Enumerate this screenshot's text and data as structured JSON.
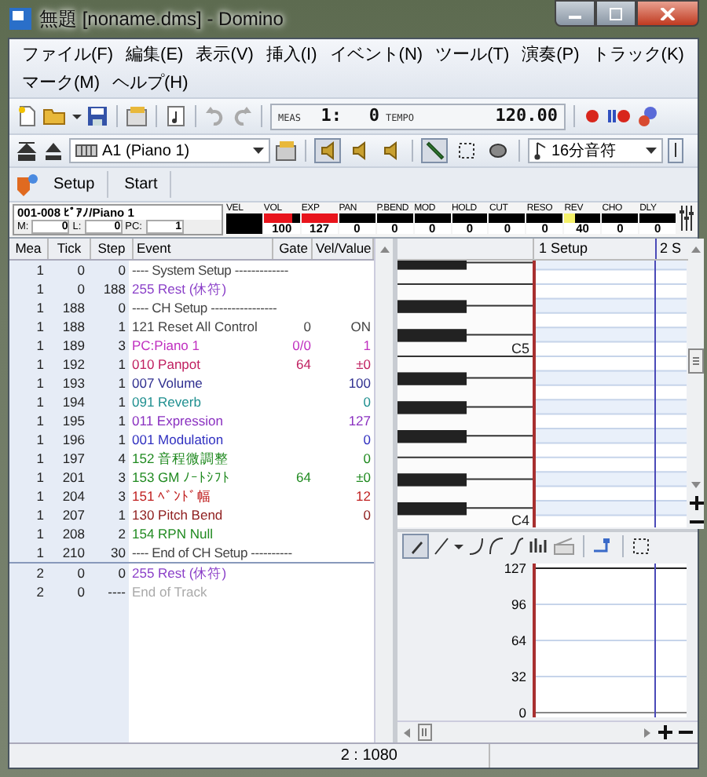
{
  "window": {
    "title": "無題 [noname.dms] - Domino"
  },
  "menu": [
    "ファイル(F)",
    "編集(E)",
    "表示(V)",
    "挿入(I)",
    "イベント(N)",
    "ツール(T)",
    "演奏(P)",
    "トラック(K)",
    "マーク(M)",
    "ヘルプ(H)"
  ],
  "transport": {
    "meas_label": "MEAS",
    "measure": "1:",
    "tick": "0",
    "tempo_label": "TEMPO",
    "tempo": "120.00"
  },
  "track_bar": {
    "track": "A1 (Piano 1)",
    "monitor_buttons": [
      {
        "selected": true
      },
      {
        "selected": false
      },
      {
        "selected": false
      }
    ],
    "tools": [
      {
        "kind": "pencil",
        "selected": true
      },
      {
        "kind": "select",
        "selected": false
      },
      {
        "kind": "eraser",
        "selected": false
      }
    ],
    "note_length": "16分音符"
  },
  "tabs": [
    {
      "label": "Setup"
    },
    {
      "label": "Start"
    }
  ],
  "channel_info": {
    "instrument": "001-008 ﾋﾟｱﾉ/Piano 1",
    "fields": [
      {
        "label": "M:",
        "value": "0"
      },
      {
        "label": "L:",
        "value": "0"
      },
      {
        "label": "PC:",
        "value": "1"
      }
    ],
    "meters": [
      {
        "label": "VEL"
      },
      {
        "label": "VOL",
        "value": "100",
        "level": 0.79,
        "color": "#e8141c"
      },
      {
        "label": "EXP",
        "value": "127",
        "level": 1,
        "color": "#e8141c"
      },
      {
        "label": "PAN",
        "value": "0"
      },
      {
        "label": "P.BEND",
        "value": "0"
      },
      {
        "label": "MOD",
        "value": "0"
      },
      {
        "label": "HOLD",
        "value": "0"
      },
      {
        "label": "CUT",
        "value": "0"
      },
      {
        "label": "RESO",
        "value": "0"
      },
      {
        "label": "REV",
        "value": "40",
        "level": 0.31,
        "color": "#f4f06a"
      },
      {
        "label": "CHO",
        "value": "0"
      },
      {
        "label": "DLY",
        "value": "0"
      }
    ]
  },
  "event_list": {
    "columns": [
      "Mea",
      "Tick",
      "Step",
      "Event",
      "Gate",
      "Vel/Value"
    ],
    "rows": [
      {
        "kind": "separator",
        "mea": "1",
        "tick": "0",
        "step": "0",
        "event": "---- System Setup -------------"
      },
      {
        "kind": "event",
        "mea": "1",
        "tick": "0",
        "step": "188",
        "event": "255 Rest (休符)",
        "color": "#8a3fc8"
      },
      {
        "kind": "separator",
        "mea": "1",
        "tick": "188",
        "step": "0",
        "event": "---- CH Setup ----------------"
      },
      {
        "kind": "event",
        "mea": "1",
        "tick": "188",
        "step": "1",
        "event": "121 Reset All Control",
        "gate": "0",
        "value": "ON",
        "color": "#444444"
      },
      {
        "kind": "event",
        "mea": "1",
        "tick": "189",
        "step": "3",
        "event": "PC:Piano 1",
        "gate": "0/0",
        "value": "1",
        "color": "#c030c0"
      },
      {
        "kind": "event",
        "mea": "1",
        "tick": "192",
        "step": "1",
        "event": "010 Panpot",
        "gate": "64",
        "value": "±0",
        "color": "#c02060"
      },
      {
        "kind": "event",
        "mea": "1",
        "tick": "193",
        "step": "1",
        "event": "007 Volume",
        "value": "100",
        "color": "#303090"
      },
      {
        "kind": "event",
        "mea": "1",
        "tick": "194",
        "step": "1",
        "event": "091 Reverb",
        "value": "0",
        "color": "#209090"
      },
      {
        "kind": "event",
        "mea": "1",
        "tick": "195",
        "step": "1",
        "event": "011 Expression",
        "value": "127",
        "color": "#8a30c0"
      },
      {
        "kind": "event",
        "mea": "1",
        "tick": "196",
        "step": "1",
        "event": "001 Modulation",
        "value": "0",
        "color": "#3030c0"
      },
      {
        "kind": "event",
        "mea": "1",
        "tick": "197",
        "step": "4",
        "event": "152 音程微調整",
        "value": "0",
        "color": "#208a20"
      },
      {
        "kind": "event",
        "mea": "1",
        "tick": "201",
        "step": "3",
        "event": "153 GM ﾉｰﾄｼﾌﾄ",
        "gate": "64",
        "value": "±0",
        "color": "#208a20"
      },
      {
        "kind": "event",
        "mea": "1",
        "tick": "204",
        "step": "3",
        "event": "151 ﾍﾞﾝﾄﾞ幅",
        "value": "12",
        "color": "#c02020"
      },
      {
        "kind": "event",
        "mea": "1",
        "tick": "207",
        "step": "1",
        "event": "130 Pitch Bend",
        "value": "0",
        "color": "#902020"
      },
      {
        "kind": "event",
        "mea": "1",
        "tick": "208",
        "step": "2",
        "event": "154 RPN Null",
        "color": "#208a20"
      },
      {
        "kind": "separator",
        "mea": "1",
        "tick": "210",
        "step": "30",
        "event": "---- End of CH Setup ----------"
      },
      {
        "kind": "event",
        "mea": "2",
        "tick": "0",
        "step": "0",
        "event": "255 Rest (休符)",
        "color": "#8a3fc8"
      },
      {
        "kind": "event",
        "mea": "2",
        "tick": "0",
        "step": "----",
        "event": "End of Track",
        "color": "#aaaaaa"
      }
    ]
  },
  "piano_roll": {
    "markers": [
      "1 Setup",
      "2 S"
    ],
    "key_labels": [
      "C5",
      "C4"
    ]
  },
  "velocity_pane": {
    "axis_labels": [
      "127",
      "96",
      "64",
      "32",
      "0"
    ]
  },
  "status_bar": {
    "position": "2 : 1080"
  }
}
